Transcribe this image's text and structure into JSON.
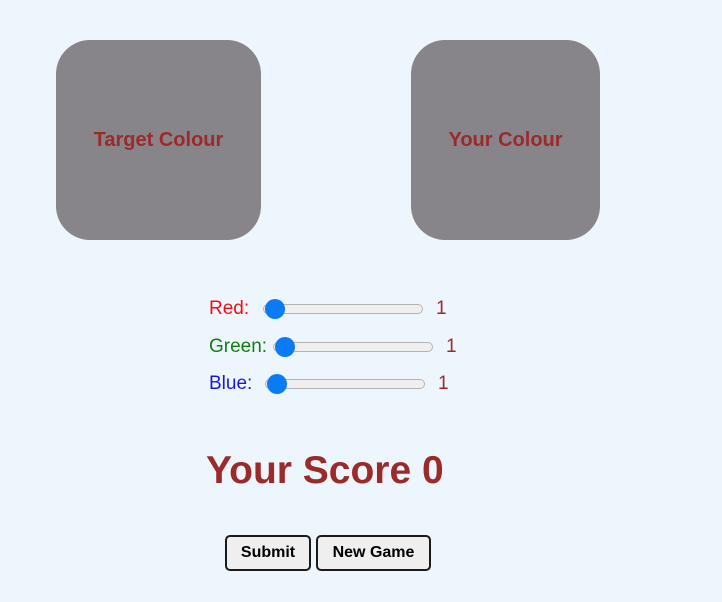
{
  "swatches": {
    "target": {
      "label": "Target Colour",
      "color": "#878589"
    },
    "yours": {
      "label": "Your Colour",
      "color": "#878589"
    },
    "label_color": "#9b2a2a"
  },
  "sliders": [
    {
      "label": "Red:",
      "value": "1",
      "min": 0,
      "max": 255,
      "label_color": "#ee1111",
      "value_color": "#9b2a2a"
    },
    {
      "label": "Green:",
      "value": "1",
      "min": 0,
      "max": 255,
      "label_color": "#127e12",
      "value_color": "#9b2a2a"
    },
    {
      "label": "Blue:",
      "value": "1",
      "min": 0,
      "max": 255,
      "label_color": "#1818dd",
      "value_color": "#9b2a2a"
    }
  ],
  "score": {
    "text": "Your Score 0",
    "color": "#9b2a2a"
  },
  "buttons": {
    "submit": "Submit",
    "new_game": "New Game"
  },
  "colors": {
    "background": "#eef6fd",
    "thumb": "#0a7bf4"
  }
}
